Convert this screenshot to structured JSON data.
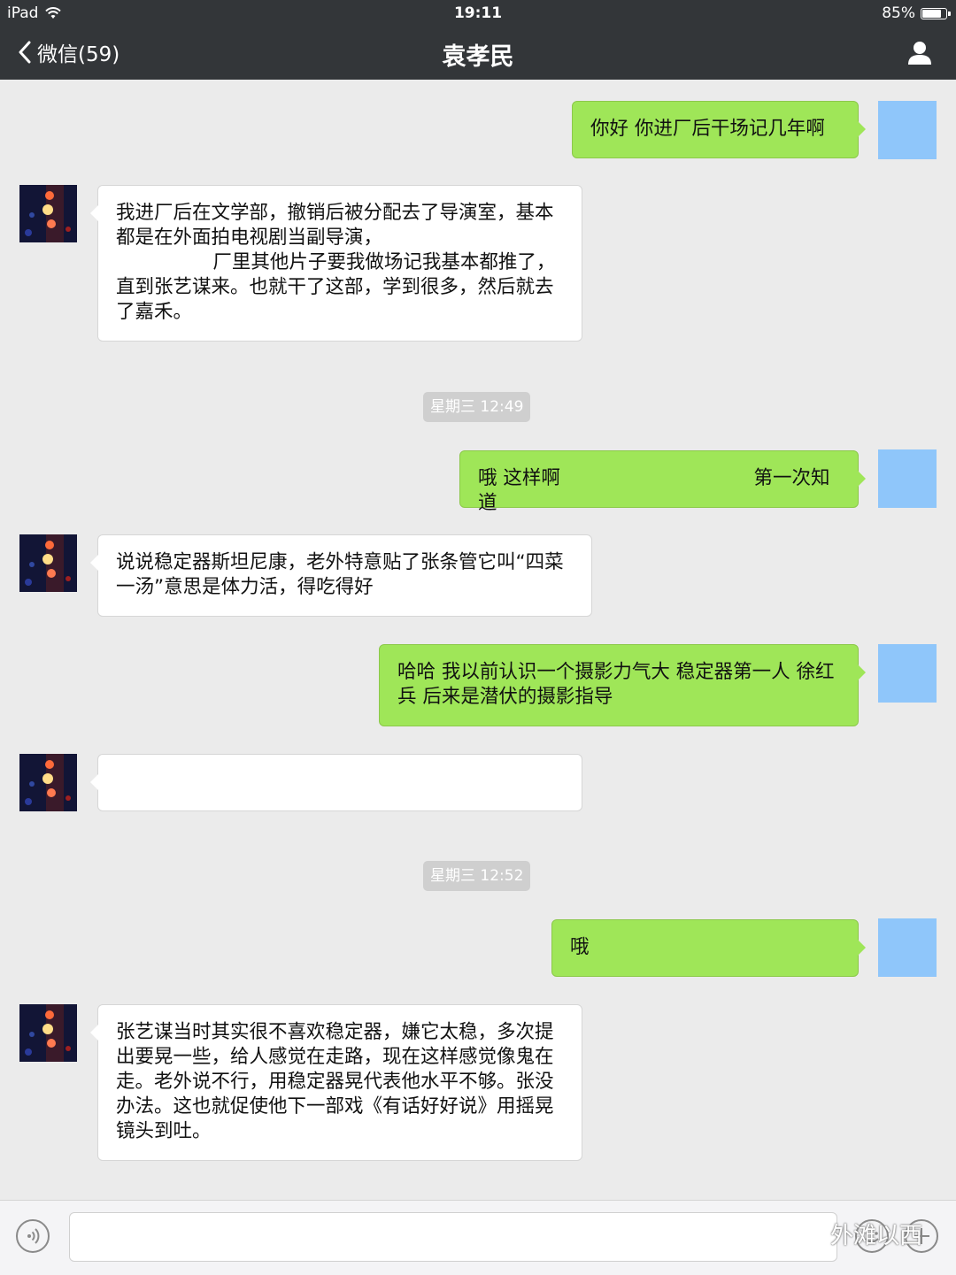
{
  "status_bar": {
    "device": "iPad",
    "time": "19:11",
    "battery_label": "85%",
    "battery_level": 0.85
  },
  "nav": {
    "back_label": "微信(59)",
    "title": "袁孝民"
  },
  "messages": [
    {
      "from": "me",
      "text": "你好 你进厂后干场记几年啊"
    },
    {
      "from": "them",
      "text": "我进厂后在文学部，撤销后被分配去了导演室，基本都是在外面拍电视剧当副导演，\n                厂里其他片子要我做场记我基本都推了，直到张艺谋来。也就干了这部，学到很多，然后就去了嘉禾。"
    },
    {
      "from": "me",
      "text": "哦 这样啊                                第一次知道"
    },
    {
      "from": "them",
      "text": "说说稳定器斯坦尼康，老外特意贴了张条管它叫“四菜一汤”意思是体力活，得吃得好"
    },
    {
      "from": "me",
      "text": "哈哈 我以前认识一个摄影力气大 稳定器第一人 徐红兵 后来是潜伏的摄影指导"
    },
    {
      "from": "them",
      "text": ""
    },
    {
      "from": "me",
      "text": "哦"
    },
    {
      "from": "them",
      "text": "张艺谋当时其实很不喜欢稳定器，嫌它太稳，多次提出要晃一些，给人感觉在走路，现在这样感觉像鬼在走。老外说不行，用稳定器晃代表他水平不够。张没办法。这也就促使他下一部戏《有话好好说》用摇晃镜头到吐。"
    }
  ],
  "timestamps": [
    "星期三 12:49",
    "星期三 12:52"
  ],
  "input": {
    "value": ""
  },
  "watermark": "外滩以西",
  "colors": {
    "nav_bg": "#333639",
    "chat_bg": "#ebebeb",
    "my_bubble": "#9fe658",
    "their_bubble": "#ffffff",
    "my_avatar": "#8fc6fa"
  }
}
